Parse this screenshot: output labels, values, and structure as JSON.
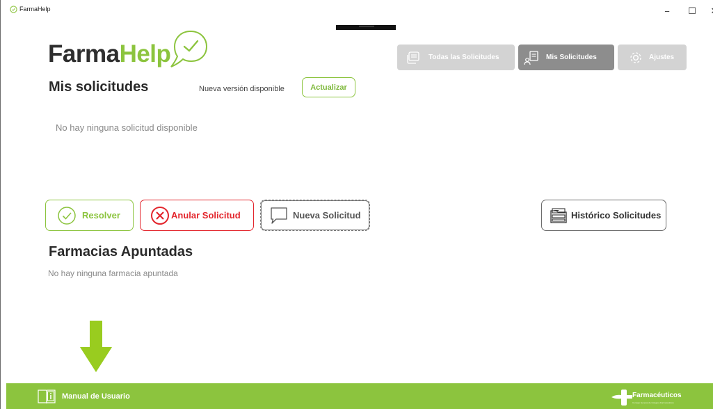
{
  "window": {
    "title": "FarmaHelp",
    "controls": {
      "minimize": "−",
      "maximize": "☐",
      "close": "✕"
    }
  },
  "logo": {
    "part1": "Farma",
    "part2": "Help"
  },
  "nav": {
    "all_requests": "Todas las Solicitudes",
    "my_requests": "Mis Solicitudes",
    "settings": "Ajustes"
  },
  "my_requests_section": {
    "title": "Mis solicitudes",
    "update_notice": "Nueva versión disponible",
    "update_button": "Actualizar",
    "empty_message": "No hay ninguna solicitud disponible"
  },
  "actions": {
    "resolve": "Resolver",
    "cancel": "Anular Solicitud",
    "new": "Nueva Solicitud",
    "history": "Histórico Solicitudes"
  },
  "pharmacies_section": {
    "title": "Farmacias Apuntadas",
    "empty_message": "No hay ninguna farmacia apuntada"
  },
  "footer": {
    "manual": "Manual de Usuario",
    "brand_name": "Farmacéuticos",
    "brand_subtitle": "Consejo General de Colegios Farmacéuticos"
  },
  "colors": {
    "brand_green": "#8cc43e",
    "danger_red": "#e3262d",
    "nav_active": "#8d8d8d",
    "nav_inactive": "#d3d3d3"
  }
}
